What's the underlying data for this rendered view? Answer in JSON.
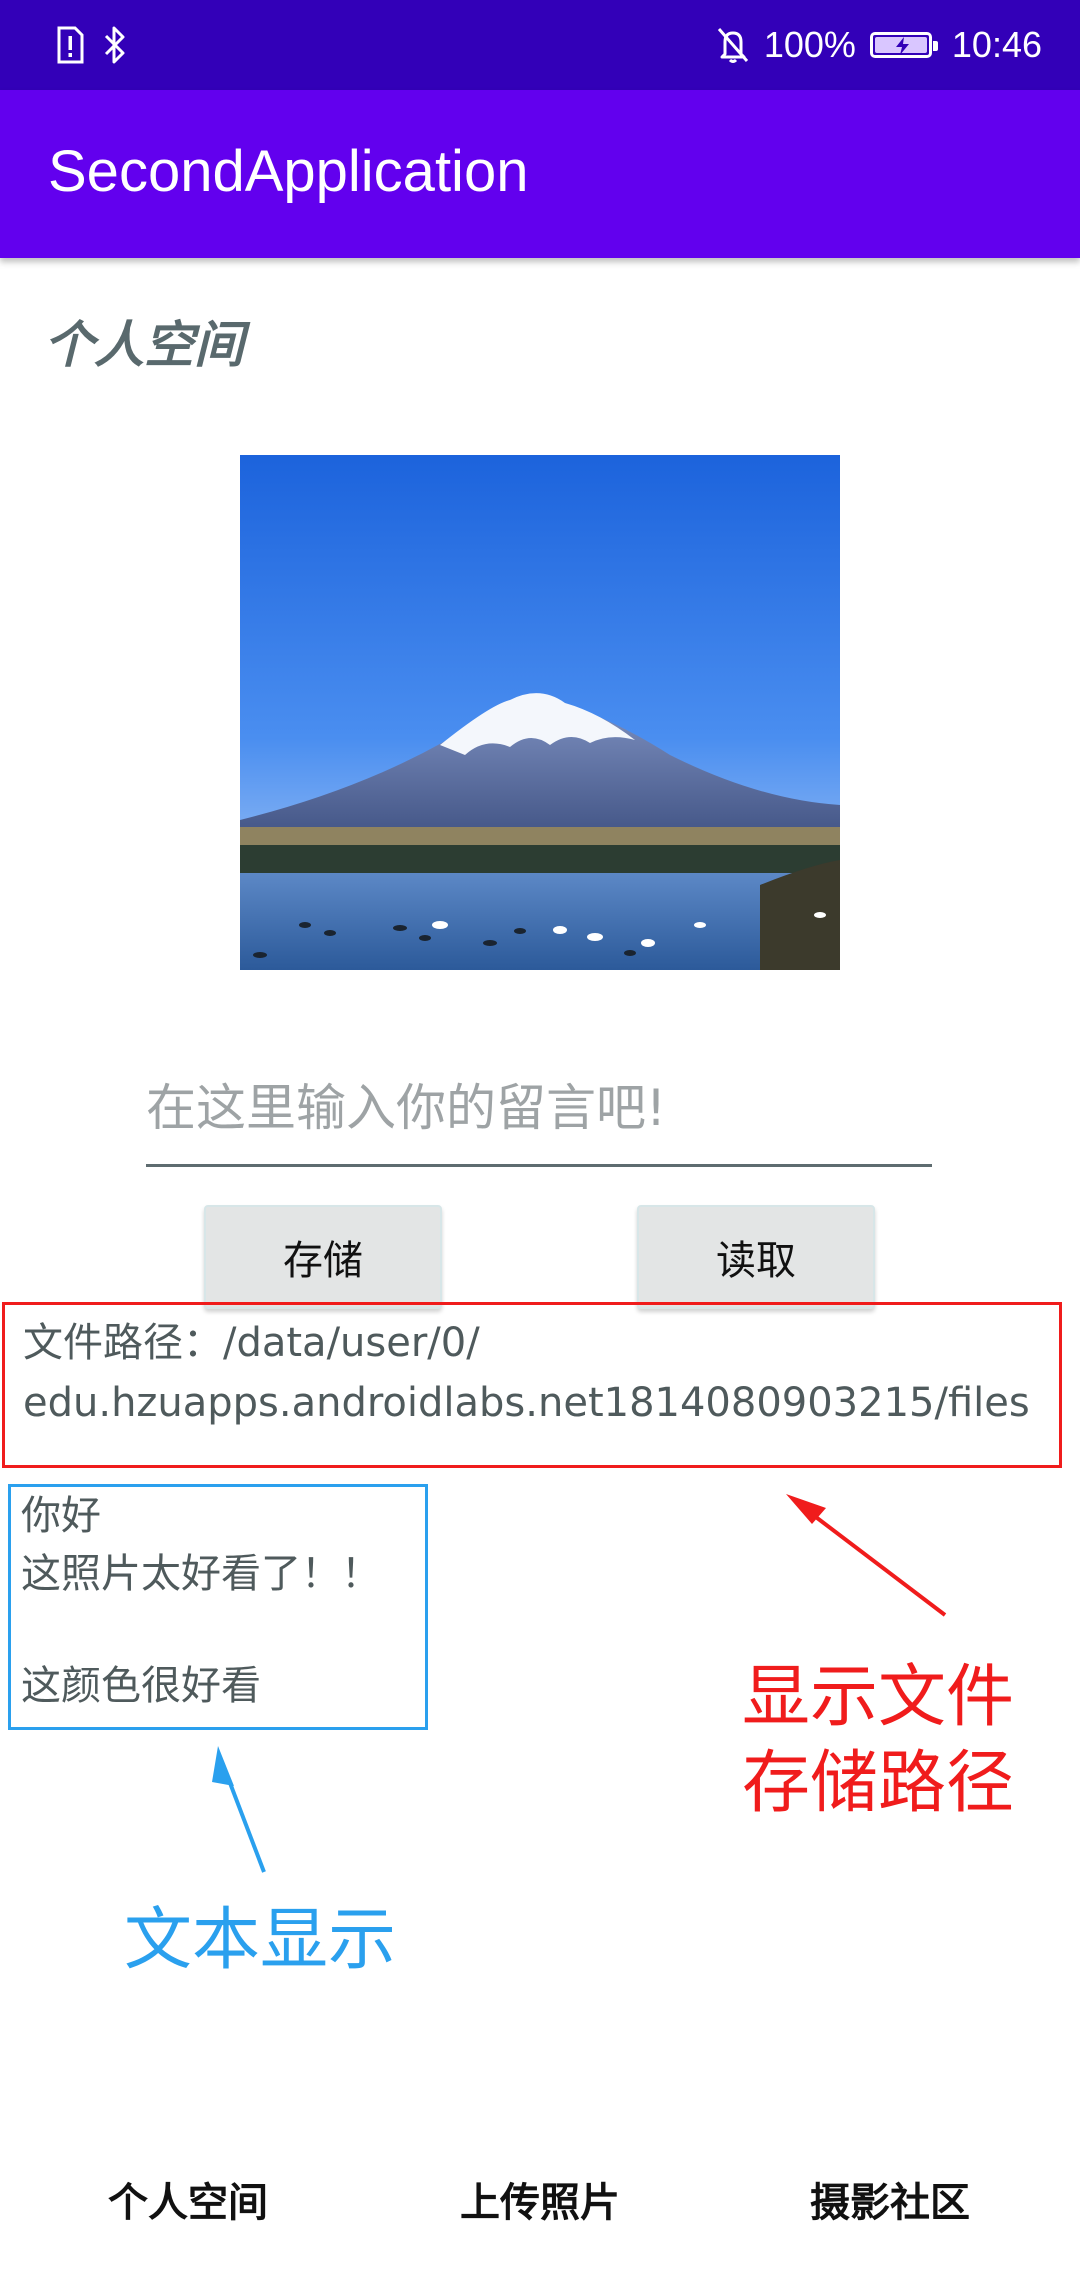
{
  "status_bar": {
    "battery_text": "100%",
    "battery_level": 1.0,
    "time": "10:46",
    "icons": [
      "alert-sim-icon",
      "bluetooth-icon",
      "mute-notification-icon",
      "battery-charging-icon"
    ]
  },
  "app_bar": {
    "title": "SecondApplication"
  },
  "page": {
    "section_title": "个人空间",
    "photo_alt": "mountain-lake-photo"
  },
  "message": {
    "placeholder": "在这里输入你的留言吧!",
    "value": ""
  },
  "buttons": {
    "save_label": "存储",
    "read_label": "读取"
  },
  "file_path": {
    "line1": "文件路径：/data/user/0/",
    "line2": "edu.hzuapps.androidlabs.net1814080903215/files"
  },
  "stored_content": {
    "line1": "你好",
    "line2": "这照片太好看了！！",
    "line3": "这颜色很好看"
  },
  "annotations": {
    "path_note_line1": "显示文件",
    "path_note_line2": "存储路径",
    "text_note": "文本显示",
    "red_color": "#f01c1c",
    "blue_color": "#2aa0ee"
  },
  "bottom_nav": {
    "items": [
      {
        "label": "个人空间"
      },
      {
        "label": "上传照片"
      },
      {
        "label": "摄影社区"
      }
    ]
  },
  "colors": {
    "status_bar": "#3300b8",
    "app_bar": "#6200ee",
    "section_title": "#59696d"
  }
}
